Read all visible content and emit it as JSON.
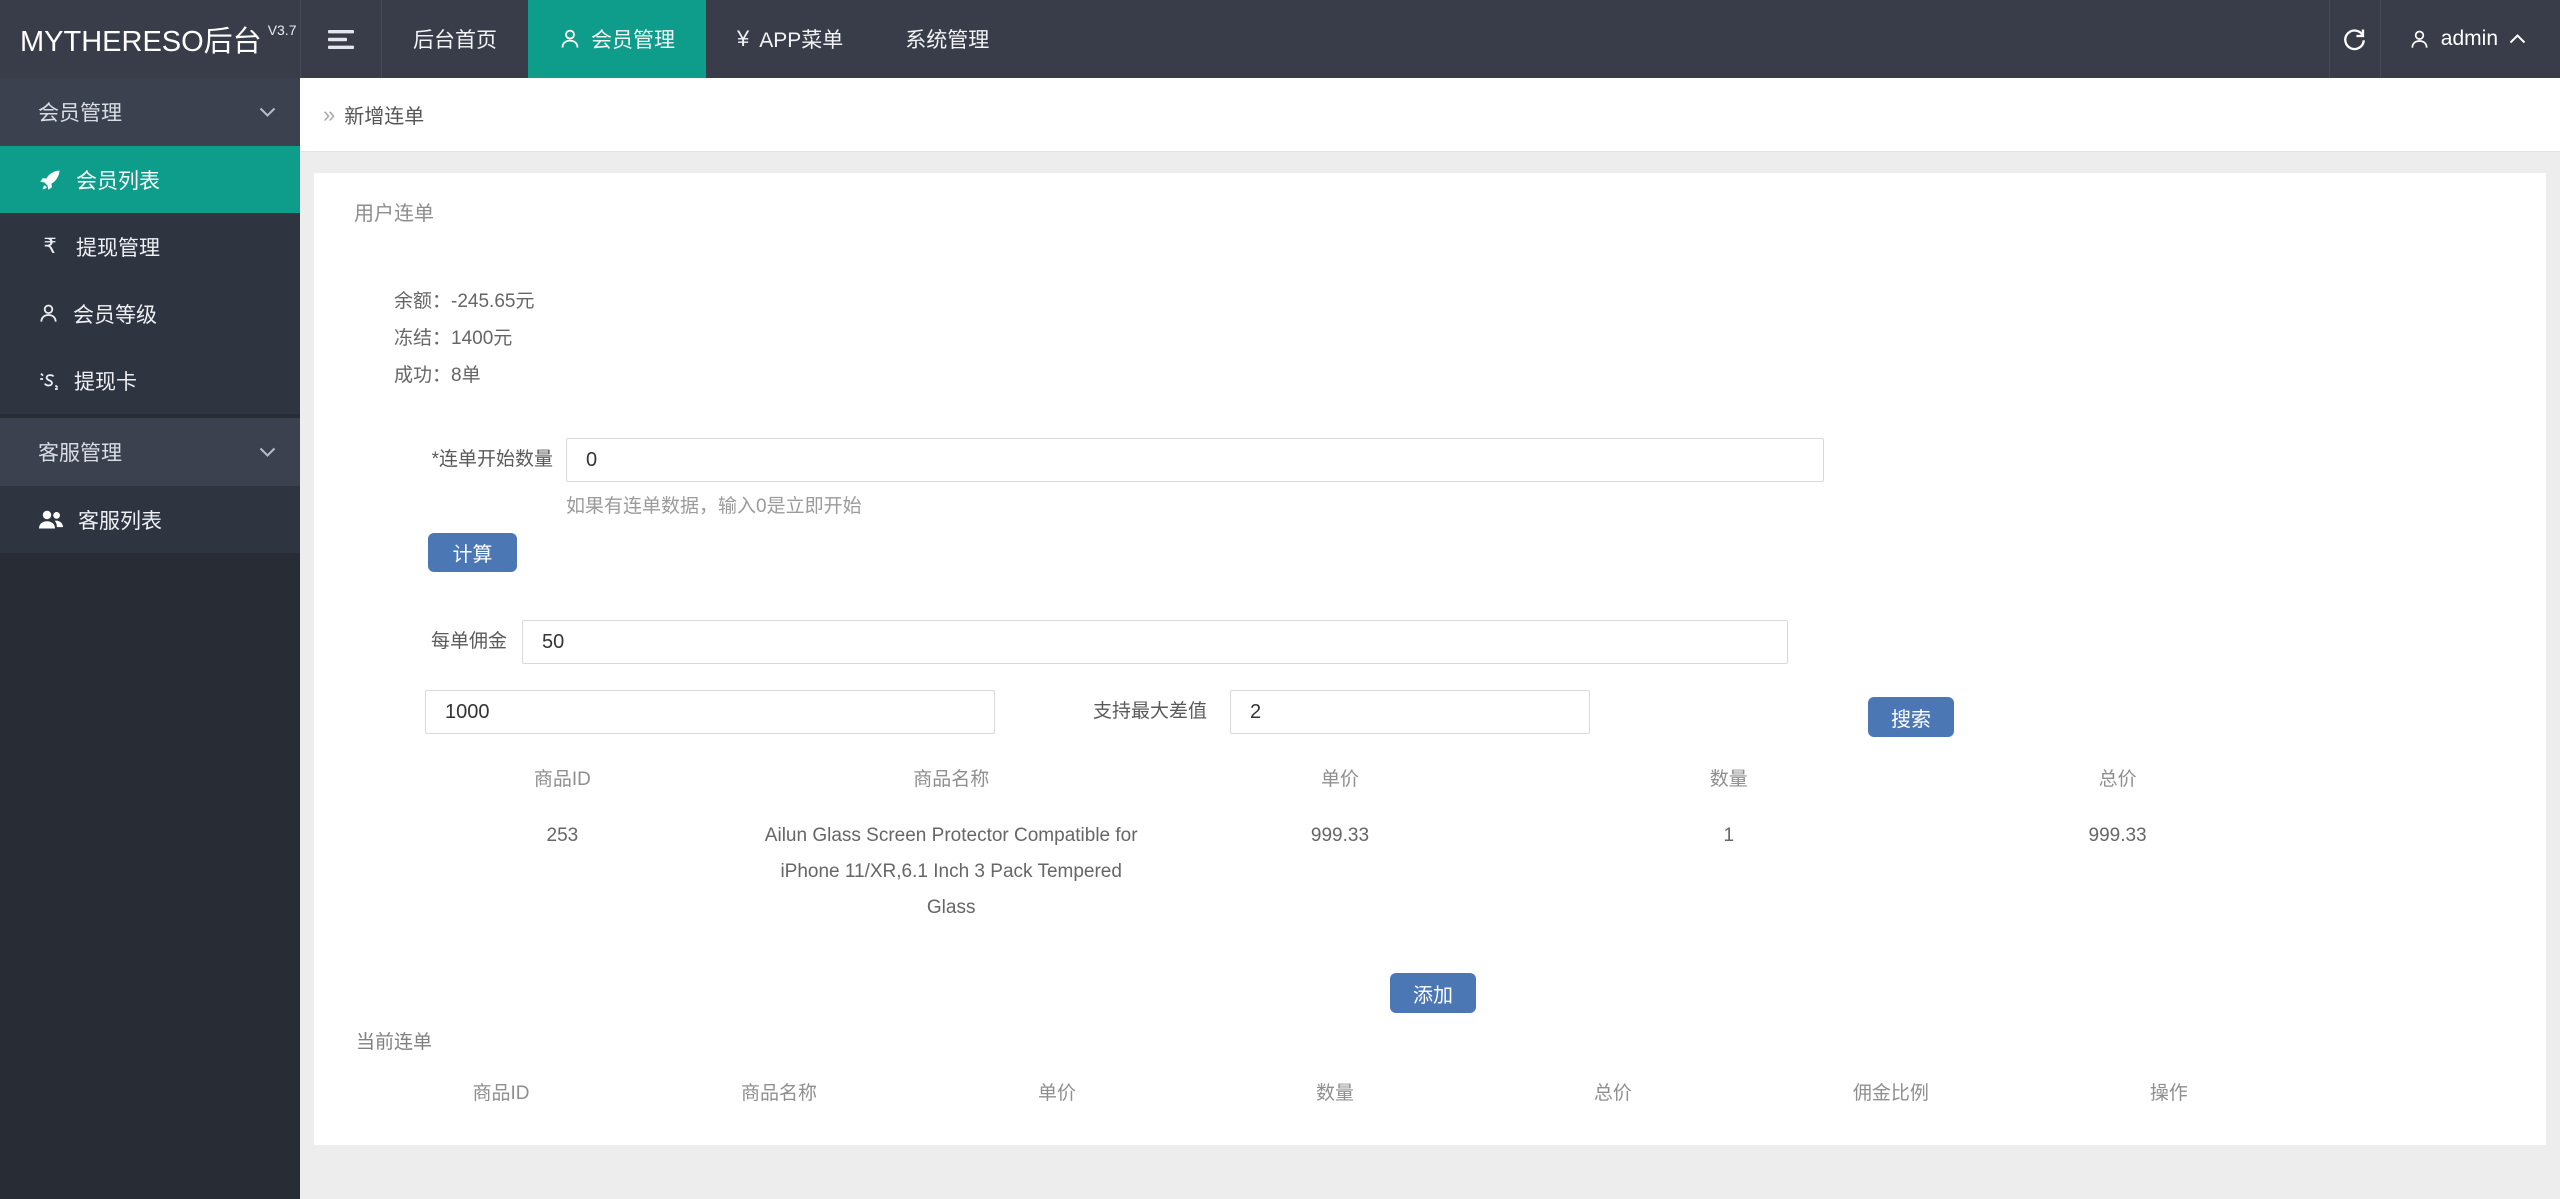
{
  "colors": {
    "accent_teal": "#0E9C8B",
    "button_blue": "#4C77B5",
    "navbar_bg": "#393D49",
    "sidebar_bg": "#272C35",
    "sidebar_group_bg": "#3B414E",
    "sidebar_item_bg": "#2E3440",
    "page_bg": "#EDEDEE"
  },
  "navbar": {
    "logo": "MYTHERESO后台",
    "version": "V3.7",
    "menu": [
      {
        "label": "后台首页"
      },
      {
        "label": "会员管理",
        "active": true,
        "icon": "person"
      },
      {
        "label": "APP菜单",
        "icon_char": "¥"
      },
      {
        "label": "系统管理"
      }
    ],
    "username": "admin"
  },
  "sidebar": {
    "groups": [
      {
        "label": "会员管理",
        "items": [
          {
            "label": "会员列表",
            "active": true,
            "icon": "rocket"
          },
          {
            "label": "提现管理",
            "icon_char": "₹"
          },
          {
            "label": "会员等级",
            "icon": "person"
          },
          {
            "label": "提现卡",
            "icon": "s-sparkle"
          }
        ]
      },
      {
        "label": "客服管理",
        "items": [
          {
            "label": "客服列表",
            "icon": "users"
          }
        ]
      }
    ]
  },
  "breadcrumb": {
    "marker": "»",
    "title": "新增连单"
  },
  "panel": {
    "section_title": "用户连单",
    "stats": [
      {
        "label": "余额：",
        "value": "-245.65元"
      },
      {
        "label": "冻结：",
        "value": "1400元"
      },
      {
        "label": "成功：",
        "value": "8单"
      }
    ],
    "form": {
      "start_qty_label": "*连单开始数量",
      "start_qty_value": "0",
      "start_qty_hint": "如果有连单数据，输入0是立即开始",
      "calc_button": "计算",
      "commission_label": "每单佣金",
      "commission_value": "50",
      "price_value": "1000",
      "max_diff_label": "支持最大差值",
      "max_diff_value": "2",
      "search_button": "搜索"
    },
    "product_table": {
      "headers": [
        "商品ID",
        "商品名称",
        "单价",
        "数量",
        "总价"
      ],
      "rows": [
        {
          "id": "253",
          "name": "Ailun Glass Screen Protector Compatible for iPhone 11/XR,6.1 Inch 3 Pack Tempered Glass",
          "price": "999.33",
          "qty": "1",
          "total": "999.33"
        }
      ]
    },
    "add_button": "添加",
    "current_title": "当前连单",
    "current_table": {
      "headers": [
        "商品ID",
        "商品名称",
        "单价",
        "数量",
        "总价",
        "佣金比例",
        "操作"
      ],
      "rows": []
    }
  }
}
